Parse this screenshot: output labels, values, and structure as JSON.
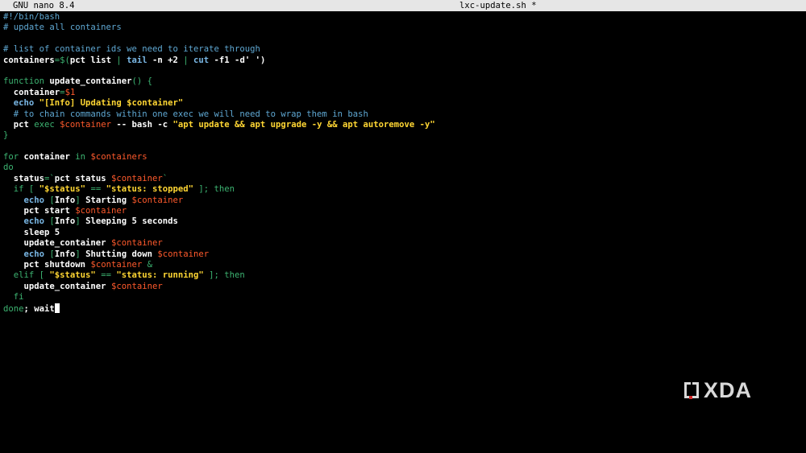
{
  "titlebar": {
    "app_name": "GNU nano 8.4",
    "file_name": "lxc-update.sh *"
  },
  "code": {
    "lines": [
      [
        {
          "t": "#!/bin/bash",
          "c": "comment"
        }
      ],
      [
        {
          "t": "# update all containers",
          "c": "comment"
        }
      ],
      [],
      [
        {
          "t": "# list of container ids we need to iterate through",
          "c": "comment"
        }
      ],
      [
        {
          "t": "containers",
          "c": "bold"
        },
        {
          "t": "=$(",
          "c": "kw"
        },
        {
          "t": "pct list ",
          "c": "bold"
        },
        {
          "t": "| ",
          "c": "kw"
        },
        {
          "t": "tail",
          "c": "builtin"
        },
        {
          "t": " -n +2 ",
          "c": "bold"
        },
        {
          "t": "| ",
          "c": "kw"
        },
        {
          "t": "cut",
          "c": "builtin"
        },
        {
          "t": " -f1 -d' ')",
          "c": "bold"
        }
      ],
      [],
      [
        {
          "t": "function ",
          "c": "kw"
        },
        {
          "t": "update_container",
          "c": "bold"
        },
        {
          "t": "() {",
          "c": "kw"
        }
      ],
      [
        {
          "t": "  container",
          "c": "bold"
        },
        {
          "t": "=",
          "c": "kw"
        },
        {
          "t": "$1",
          "c": "var"
        }
      ],
      [
        {
          "t": "  ",
          "c": "plain"
        },
        {
          "t": "echo",
          "c": "builtin"
        },
        {
          "t": " \"[Info] Updating ",
          "c": "str"
        },
        {
          "t": "$container",
          "c": "str"
        },
        {
          "t": "\"",
          "c": "str"
        }
      ],
      [
        {
          "t": "  # to chain commands within one exec we will need to wrap them in bash",
          "c": "comment"
        }
      ],
      [
        {
          "t": "  pct ",
          "c": "bold"
        },
        {
          "t": "exec ",
          "c": "kw"
        },
        {
          "t": "$container",
          "c": "var"
        },
        {
          "t": " -- bash -c ",
          "c": "bold"
        },
        {
          "t": "\"apt update && apt upgrade -y && apt autoremove -y\"",
          "c": "str"
        }
      ],
      [
        {
          "t": "}",
          "c": "kw"
        }
      ],
      [],
      [
        {
          "t": "for ",
          "c": "kw"
        },
        {
          "t": "container ",
          "c": "bold"
        },
        {
          "t": "in ",
          "c": "kw"
        },
        {
          "t": "$containers",
          "c": "var"
        }
      ],
      [
        {
          "t": "do",
          "c": "kw"
        }
      ],
      [
        {
          "t": "  status",
          "c": "bold"
        },
        {
          "t": "=`",
          "c": "kw"
        },
        {
          "t": "pct status ",
          "c": "bold"
        },
        {
          "t": "$container",
          "c": "var"
        },
        {
          "t": "`",
          "c": "kw"
        }
      ],
      [
        {
          "t": "  if [ ",
          "c": "kw"
        },
        {
          "t": "\"$status\"",
          "c": "str"
        },
        {
          "t": " == ",
          "c": "kw"
        },
        {
          "t": "\"status: stopped\"",
          "c": "str"
        },
        {
          "t": " ]; then",
          "c": "kw"
        }
      ],
      [
        {
          "t": "    ",
          "c": "plain"
        },
        {
          "t": "echo",
          "c": "builtin"
        },
        {
          "t": " [",
          "c": "kw"
        },
        {
          "t": "Info",
          "c": "bold"
        },
        {
          "t": "] ",
          "c": "kw"
        },
        {
          "t": "Starting ",
          "c": "bold"
        },
        {
          "t": "$container",
          "c": "var"
        }
      ],
      [
        {
          "t": "    pct start ",
          "c": "bold"
        },
        {
          "t": "$container",
          "c": "var"
        }
      ],
      [
        {
          "t": "    ",
          "c": "plain"
        },
        {
          "t": "echo",
          "c": "builtin"
        },
        {
          "t": " [",
          "c": "kw"
        },
        {
          "t": "Info",
          "c": "bold"
        },
        {
          "t": "] ",
          "c": "kw"
        },
        {
          "t": "Sleeping 5 seconds",
          "c": "bold"
        }
      ],
      [
        {
          "t": "    sleep 5",
          "c": "bold"
        }
      ],
      [
        {
          "t": "    update_container ",
          "c": "bold"
        },
        {
          "t": "$container",
          "c": "var"
        }
      ],
      [
        {
          "t": "    ",
          "c": "plain"
        },
        {
          "t": "echo",
          "c": "builtin"
        },
        {
          "t": " [",
          "c": "kw"
        },
        {
          "t": "Info",
          "c": "bold"
        },
        {
          "t": "] ",
          "c": "kw"
        },
        {
          "t": "Shutting down ",
          "c": "bold"
        },
        {
          "t": "$container",
          "c": "var"
        }
      ],
      [
        {
          "t": "    pct shutdown ",
          "c": "bold"
        },
        {
          "t": "$container",
          "c": "var"
        },
        {
          "t": " &",
          "c": "kw"
        }
      ],
      [
        {
          "t": "  elif [ ",
          "c": "kw"
        },
        {
          "t": "\"$status\"",
          "c": "str"
        },
        {
          "t": " == ",
          "c": "kw"
        },
        {
          "t": "\"status: running\"",
          "c": "str"
        },
        {
          "t": " ]; then",
          "c": "kw"
        }
      ],
      [
        {
          "t": "    update_container ",
          "c": "bold"
        },
        {
          "t": "$container",
          "c": "var"
        }
      ],
      [
        {
          "t": "  fi",
          "c": "kw"
        }
      ],
      [
        {
          "t": "done",
          "c": "kw"
        },
        {
          "t": "; wait",
          "c": "bold"
        }
      ]
    ]
  },
  "watermark": {
    "text": "XDA"
  },
  "colors": {
    "background": "#000000",
    "titlebar": "#e6e6e6",
    "comment": "#5fa8d3",
    "keyword": "#3cb371",
    "variable": "#ff5a2c",
    "string": "#ffd633"
  }
}
